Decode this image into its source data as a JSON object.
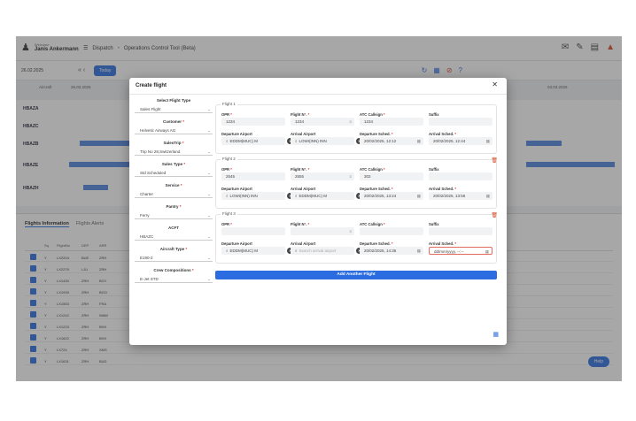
{
  "topbar": {
    "welcome": "Welcome",
    "user_name": "Janis Ankermann",
    "breadcrumb": [
      "Dispatch",
      "Operations Control Tool (Beta)"
    ]
  },
  "toolbar": {
    "date": "26.02.2025",
    "today_label": "Today"
  },
  "gantt": {
    "header_left": "Aircraft",
    "header_date": "26.02.2025",
    "header_date_right": "03.03.2025",
    "rows": [
      "HBAZA",
      "HBAZC",
      "HBAZB",
      "HBAZE",
      "HBAZH"
    ]
  },
  "bottom": {
    "tabs": [
      "Flights Information",
      "Flights Alerts"
    ],
    "columns": [
      "Sq",
      "FlightNo",
      "DEP",
      "ARR"
    ],
    "rows": [
      [
        "Y",
        "LX2204",
        "BUE",
        "ZRH"
      ],
      [
        "Y",
        "LX2279",
        "LJU",
        "ZRH"
      ],
      [
        "Y",
        "LX1430",
        "ZRH",
        "BGY"
      ],
      [
        "Y",
        "LX1939",
        "ZRH",
        "BGO"
      ],
      [
        "Y",
        "LX1553",
        "ZRH",
        "FRA"
      ],
      [
        "Y",
        "LX1242",
        "ZRH",
        "WAW"
      ],
      [
        "Y",
        "LX1223",
        "ZRH",
        "BHX"
      ],
      [
        "Y",
        "LX1622",
        "ZRH",
        "BHX"
      ],
      [
        "Y",
        "LX724",
        "ZRH",
        "XMS"
      ],
      [
        "Y",
        "LX1631",
        "ZRH",
        "BUD"
      ]
    ],
    "help_label": "Help"
  },
  "modal": {
    "title": "Create flight",
    "left": [
      {
        "label": "Select Flight Type",
        "value": "Sales Flight",
        "req": false
      },
      {
        "label": "Customer",
        "value": "Helvetic Airways AG",
        "req": true
      },
      {
        "label": "SalesTrip",
        "value": "Trip No 28,Switzerland",
        "req": true
      },
      {
        "label": "Sales Type",
        "value": "Std Scheduled",
        "req": true
      },
      {
        "label": "Service",
        "value": "Charter",
        "req": true
      },
      {
        "label": "Pantry",
        "value": "Ferry",
        "req": true
      },
      {
        "label": "ACFT",
        "value": "HBAZC",
        "req": false
      },
      {
        "label": "Aircraft Type",
        "value": "E190-2",
        "req": true
      },
      {
        "label": "Crew Compositions",
        "value": "E-Jet STD",
        "req": true
      }
    ],
    "cards": [
      {
        "title": "Flight 1",
        "opr": "1234",
        "flight_no": "1234",
        "atc": "1234",
        "suffix": "",
        "dep": "EDDM(MUC) M",
        "arr": "LOWI(INN) INN",
        "dep_sched": "20/02/2025, 12:12",
        "arr_sched": "20/02/2025, 12:44"
      },
      {
        "title": "Flight 2",
        "opr": "2545",
        "flight_no": "2555",
        "atc": "302",
        "suffix": "",
        "dep": "LOWI(INN) INN",
        "arr": "EDDM(MUC) M",
        "dep_sched": "20/02/2025, 13:24",
        "arr_sched": "20/02/2025, 13:56"
      },
      {
        "title": "Flight 3",
        "opr": "",
        "flight_no": "",
        "atc": "",
        "suffix": "",
        "dep": "EDDM(MUC) M",
        "arr": "",
        "dep_sched": "20/02/2025, 14:36",
        "arr_sched": "dd/mm/yyyy, --:--"
      }
    ],
    "field_labels": {
      "opr": "OPR",
      "flight_no": "Flight N°.",
      "atc": "ATC Callsign",
      "suffix": "Suffix",
      "dep": "Departure Airport",
      "arr": "Arrival Airport",
      "dep_sched": "Departure Sched.",
      "arr_sched": "Arrival Sched."
    },
    "arrival_placeholder": "Search arrival airport",
    "add_button": "Add Another Flight"
  }
}
